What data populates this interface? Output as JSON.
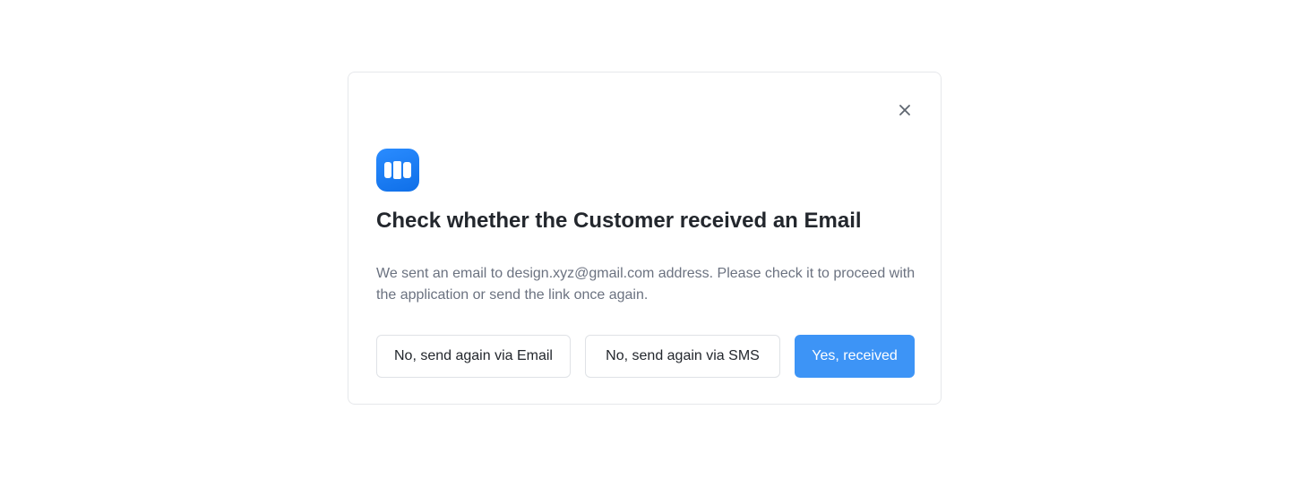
{
  "modal": {
    "close_icon": "close-icon",
    "logo_icon": "app-logo-icon",
    "title": "Check whether the Customer received an Email",
    "description": "We sent an email to design.xyz@gmail.com address. Please check it to proceed with the application or send the link once again.",
    "buttons": {
      "resend_email": "No, send again via Email",
      "resend_sms": "No, send again via SMS",
      "confirm": "Yes, received"
    }
  },
  "colors": {
    "primary": "#3d94f6",
    "logo": "#1a7ef5",
    "border": "#e6e8eb",
    "text_muted": "#6b7280"
  }
}
